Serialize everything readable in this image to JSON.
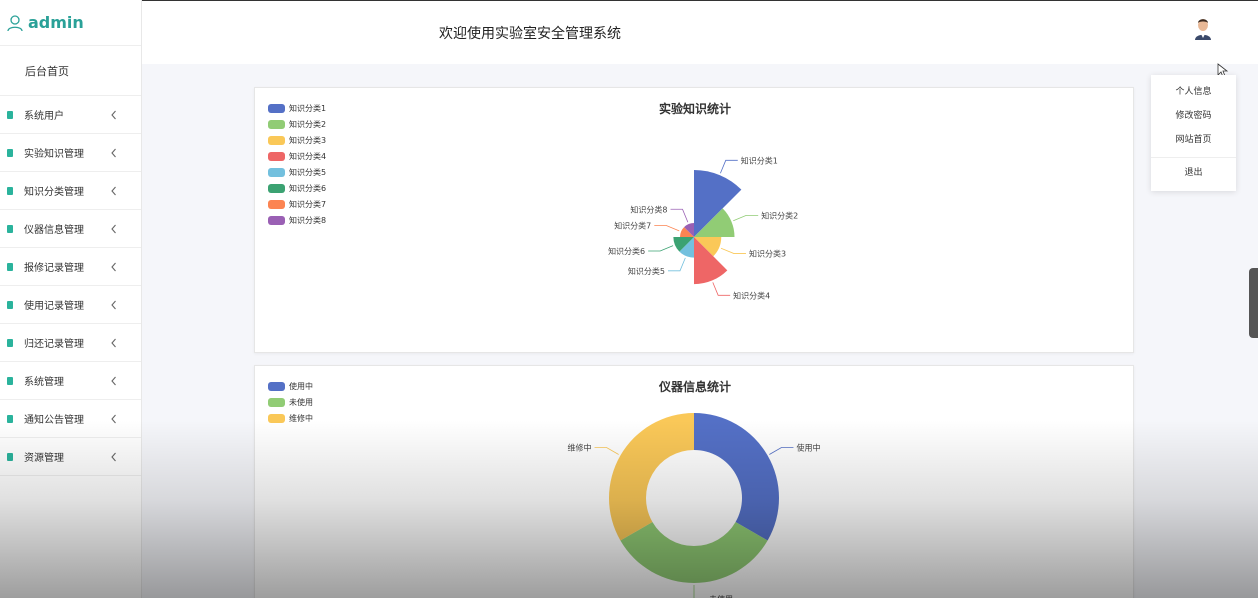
{
  "sidebar": {
    "brand": "admin",
    "home": "后台首页",
    "items": [
      {
        "label": "系统用户"
      },
      {
        "label": "实验知识管理"
      },
      {
        "label": "知识分类管理"
      },
      {
        "label": "仪器信息管理"
      },
      {
        "label": "报修记录管理"
      },
      {
        "label": "使用记录管理"
      },
      {
        "label": "归还记录管理"
      },
      {
        "label": "系统管理"
      },
      {
        "label": "通知公告管理"
      },
      {
        "label": "资源管理"
      }
    ],
    "accent": "#2ab39c"
  },
  "header": {
    "title": "欢迎使用实验室安全管理系统"
  },
  "dropdown": {
    "items": [
      "个人信息",
      "修改密码",
      "网站首页"
    ],
    "logout": "退出"
  },
  "chart_data": [
    {
      "type": "pie",
      "variant": "rose",
      "title": "实验知识统计",
      "legend_position": "top-left",
      "categories": [
        "知识分类1",
        "知识分类2",
        "知识分类3",
        "知识分类4",
        "知识分类5",
        "知识分类6",
        "知识分类7",
        "知识分类8"
      ],
      "values": [
        10,
        6,
        4,
        7,
        3,
        3,
        2,
        2
      ],
      "colors": [
        "#5470c6",
        "#91cc75",
        "#fac858",
        "#ee6666",
        "#73c0de",
        "#3ba272",
        "#fc8452",
        "#9a60b4"
      ]
    },
    {
      "type": "pie",
      "variant": "donut",
      "title": "仪器信息统计",
      "legend_position": "top-left",
      "categories": [
        "使用中",
        "未使用",
        "维修中"
      ],
      "values": [
        1,
        1,
        1
      ],
      "colors": [
        "#5470c6",
        "#91cc75",
        "#fac858"
      ]
    }
  ]
}
